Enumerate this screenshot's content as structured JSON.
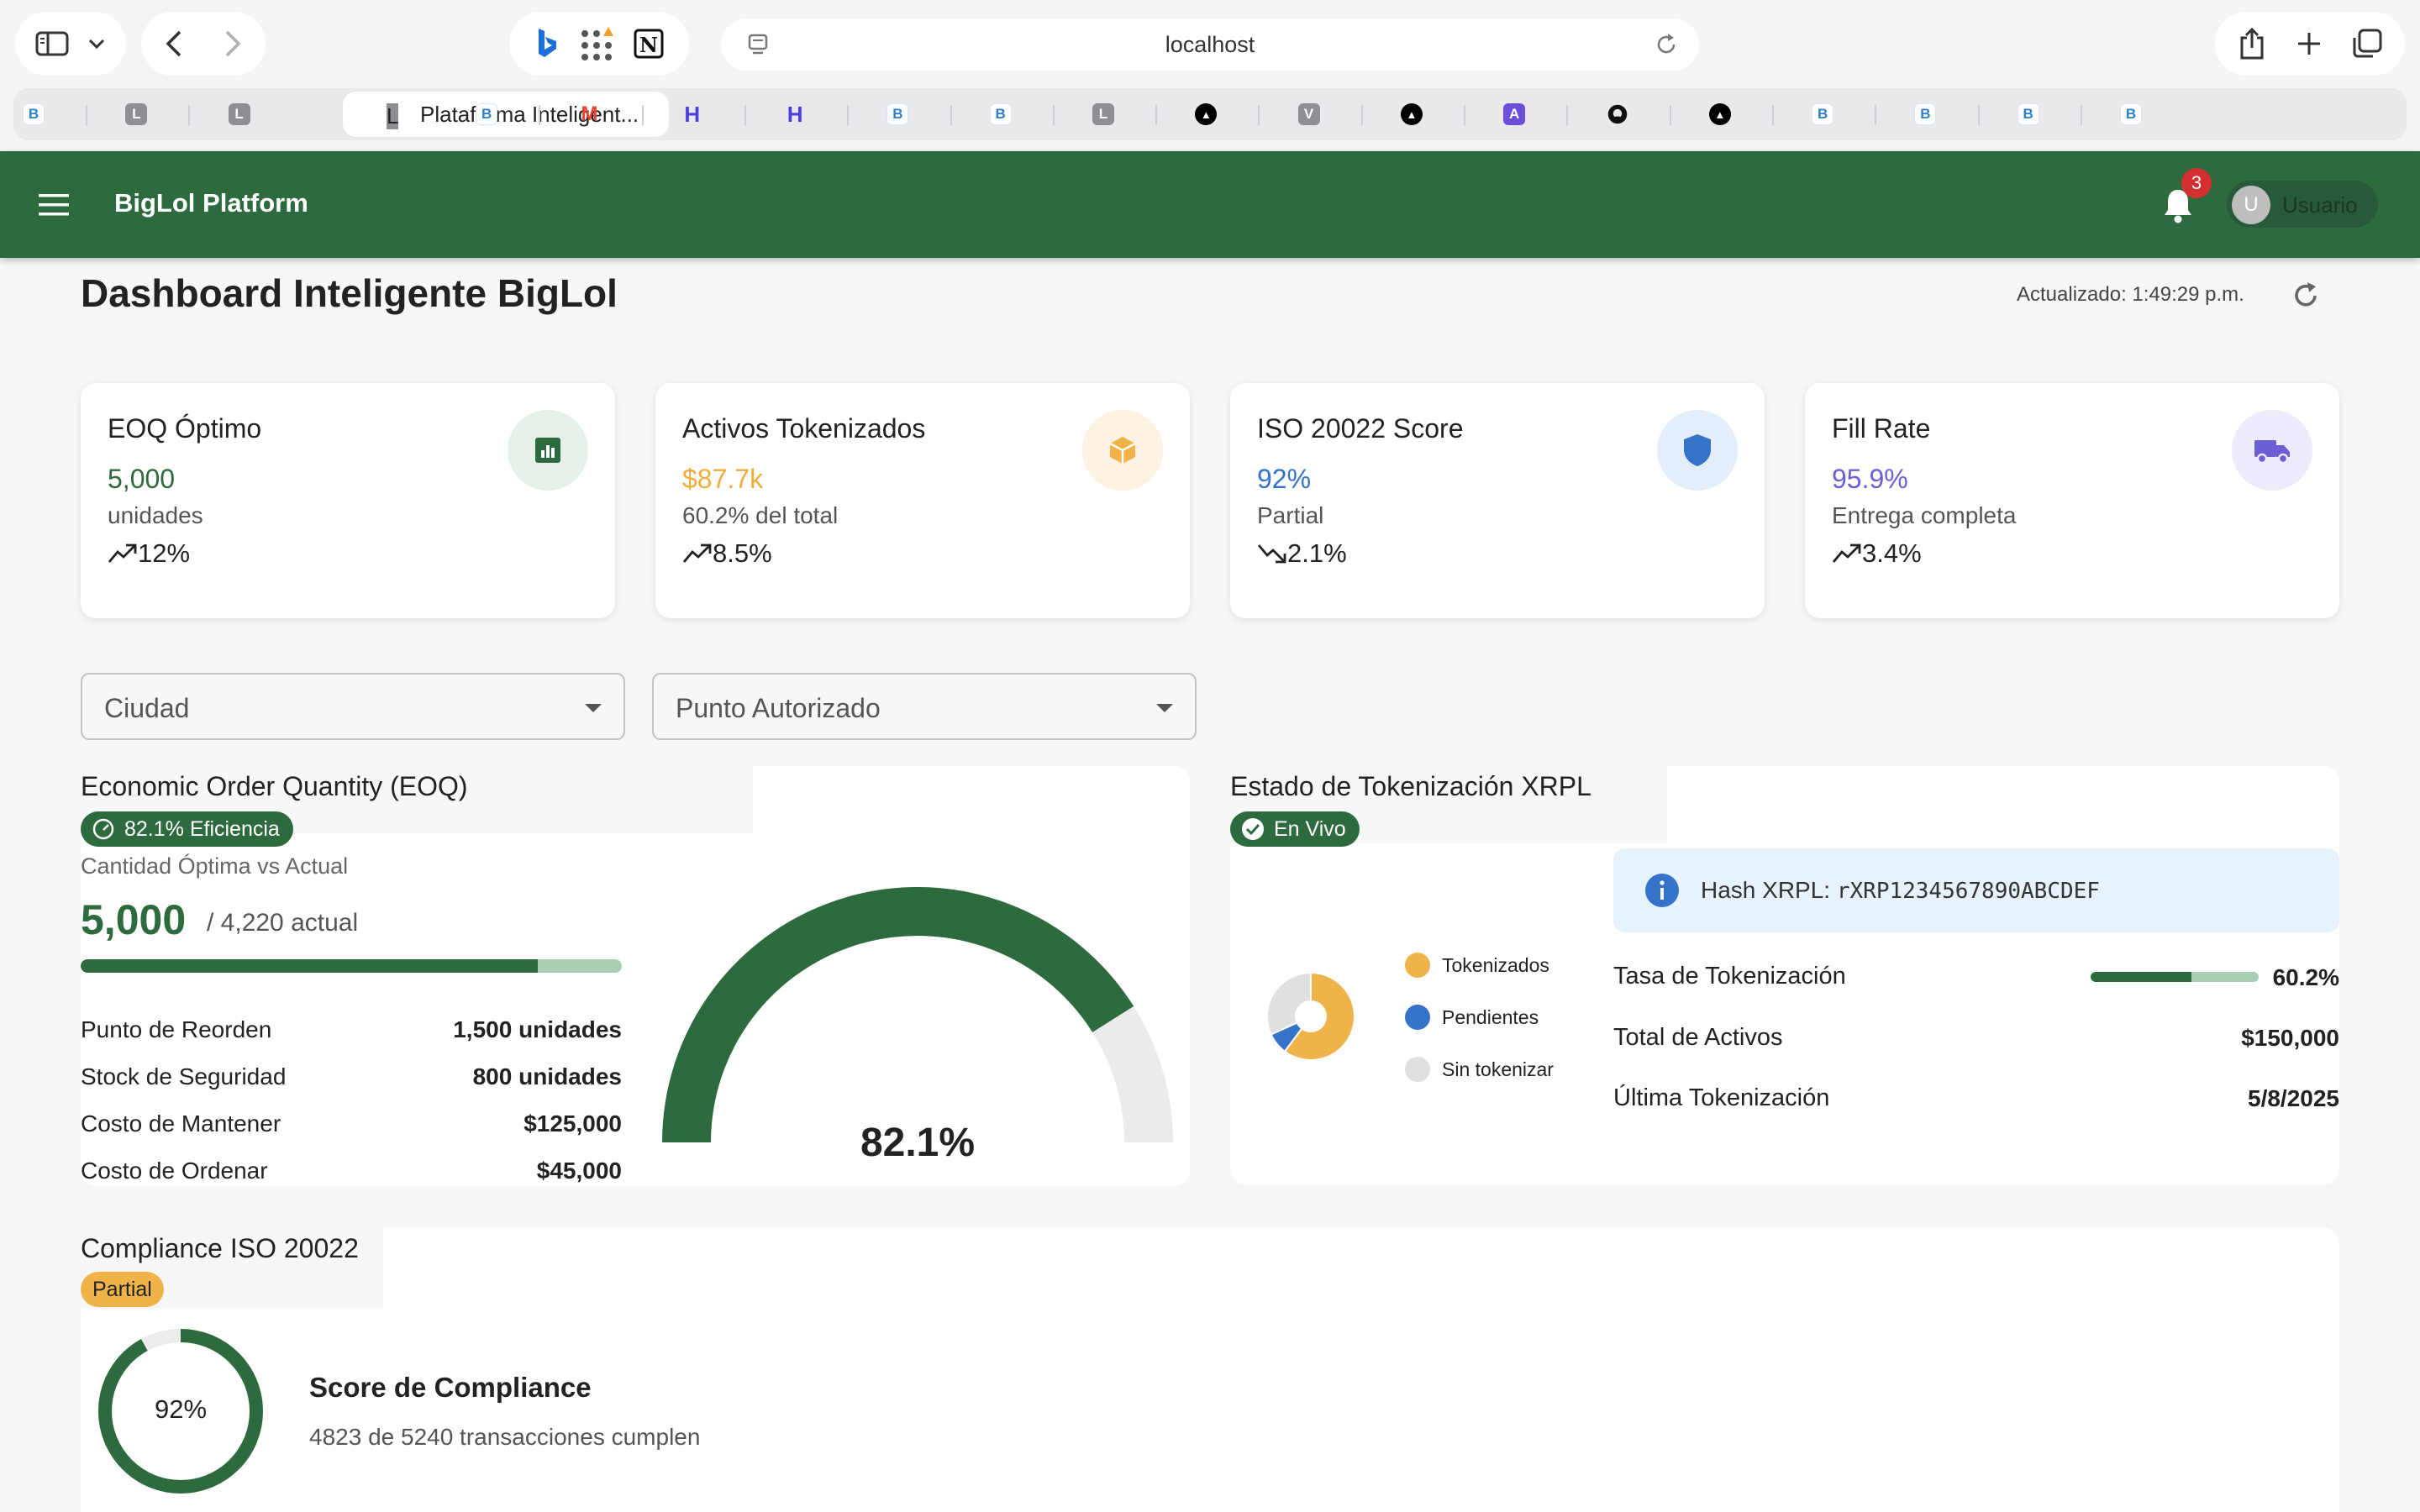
{
  "browser": {
    "address": "localhost",
    "active_tab": {
      "title": "Plataforma Inteligent...",
      "favicon": "L"
    },
    "tabs": [
      {
        "favicon": "B",
        "color": "#2f80c9"
      },
      {
        "favicon": "L",
        "color": "#8e8e93"
      },
      {
        "favicon": "L",
        "color": "#8e8e93"
      },
      {
        "favicon": "B",
        "color": "#2f80c9"
      },
      {
        "favicon": "M",
        "color": "#ea4335"
      },
      {
        "favicon": "H",
        "color": "#4a3fd8"
      },
      {
        "favicon": "H",
        "color": "#4a3fd8"
      },
      {
        "favicon": "B",
        "color": "#2f80c9"
      },
      {
        "favicon": "B",
        "color": "#2f80c9"
      },
      {
        "favicon": "L",
        "color": "#8e8e93"
      },
      {
        "favicon": "▲",
        "color": "#000000"
      },
      {
        "favicon": "V",
        "color": "#8e8e93"
      },
      {
        "favicon": "▲",
        "color": "#000000"
      },
      {
        "favicon": "A",
        "color": "#6b4fd8"
      },
      {
        "favicon": "github-icon",
        "color": "#111111"
      },
      {
        "favicon": "▲",
        "color": "#000000"
      },
      {
        "favicon": "B",
        "color": "#2f80c9"
      },
      {
        "favicon": "B",
        "color": "#2f80c9"
      },
      {
        "favicon": "B",
        "color": "#2f80c9"
      },
      {
        "favicon": "B",
        "color": "#2f80c9"
      }
    ]
  },
  "appbar": {
    "title": "BigLol Platform",
    "notification_count": "3",
    "user_initial": "U",
    "user_name": "Usuario",
    "color": "#2d6a3e"
  },
  "header": {
    "title": "Dashboard Inteligente BigLol",
    "updated": "Actualizado: 1:49:29 p.m."
  },
  "kpis": [
    {
      "title": "EOQ Óptimo",
      "value": "5,000",
      "value_color": "#2d6a3e",
      "sub": "unidades",
      "trend": "12%",
      "trend_dir": "up",
      "icon": "bar-chart-icon"
    },
    {
      "title": "Activos Tokenizados",
      "value": "$87.7k",
      "value_color": "#f0ad3c",
      "sub": "60.2% del total",
      "trend": "8.5%",
      "trend_dir": "up",
      "icon": "box-icon"
    },
    {
      "title": "ISO 20022 Score",
      "value": "92%",
      "value_color": "#3573c9",
      "sub": "Partial",
      "trend": "2.1%",
      "trend_dir": "down",
      "icon": "shield-icon"
    },
    {
      "title": "Fill Rate",
      "value": "95.9%",
      "value_color": "#6b5fd6",
      "sub": "Entrega completa",
      "trend": "3.4%",
      "trend_dir": "up",
      "icon": "truck-icon"
    }
  ],
  "filters": {
    "city": "Ciudad",
    "point": "Punto Autorizado"
  },
  "eoq": {
    "title": "Economic Order Quantity (EOQ)",
    "efficiency_chip": "82.1% Eficiencia",
    "subtitle": "Cantidad Óptima vs Actual",
    "optimal": "5,000",
    "actual": "/ 4,220 actual",
    "progress": 0.844,
    "rows": [
      {
        "label": "Punto de Reorden",
        "value": "1,500 unidades"
      },
      {
        "label": "Stock de Seguridad",
        "value": "800 unidades"
      },
      {
        "label": "Costo de Mantener",
        "value": "$125,000"
      },
      {
        "label": "Costo de Ordenar",
        "value": "$45,000"
      }
    ],
    "gauge_value": 0.821,
    "gauge_label": "82.1%"
  },
  "tokenization": {
    "title": "Estado de Tokenización XRPL",
    "live_chip": "En Vivo",
    "legend": [
      {
        "label": "Tokenizados",
        "color": "#f0b34a",
        "share": 0.602
      },
      {
        "label": "Pendientes",
        "color": "#3573c9",
        "share": 0.08
      },
      {
        "label": "Sin tokenizar",
        "color": "#e0e0e0",
        "share": 0.318
      }
    ],
    "hash_label": "Hash XRPL: ",
    "hash_value": "rXRP1234567890ABCDEF",
    "rate_label": "Tasa de Tokenización",
    "rate_value": "60.2%",
    "rate": 0.602,
    "total_label": "Total de Activos",
    "total_value": "$150,000",
    "last_label": "Última Tokenización",
    "last_value": "5/8/2025"
  },
  "compliance": {
    "title": "Compliance ISO 20022",
    "status_chip": "Partial",
    "score": 0.92,
    "score_label": "92%",
    "score_title": "Score de Compliance",
    "score_sub": "4823 de 5240 transacciones cumplen"
  }
}
